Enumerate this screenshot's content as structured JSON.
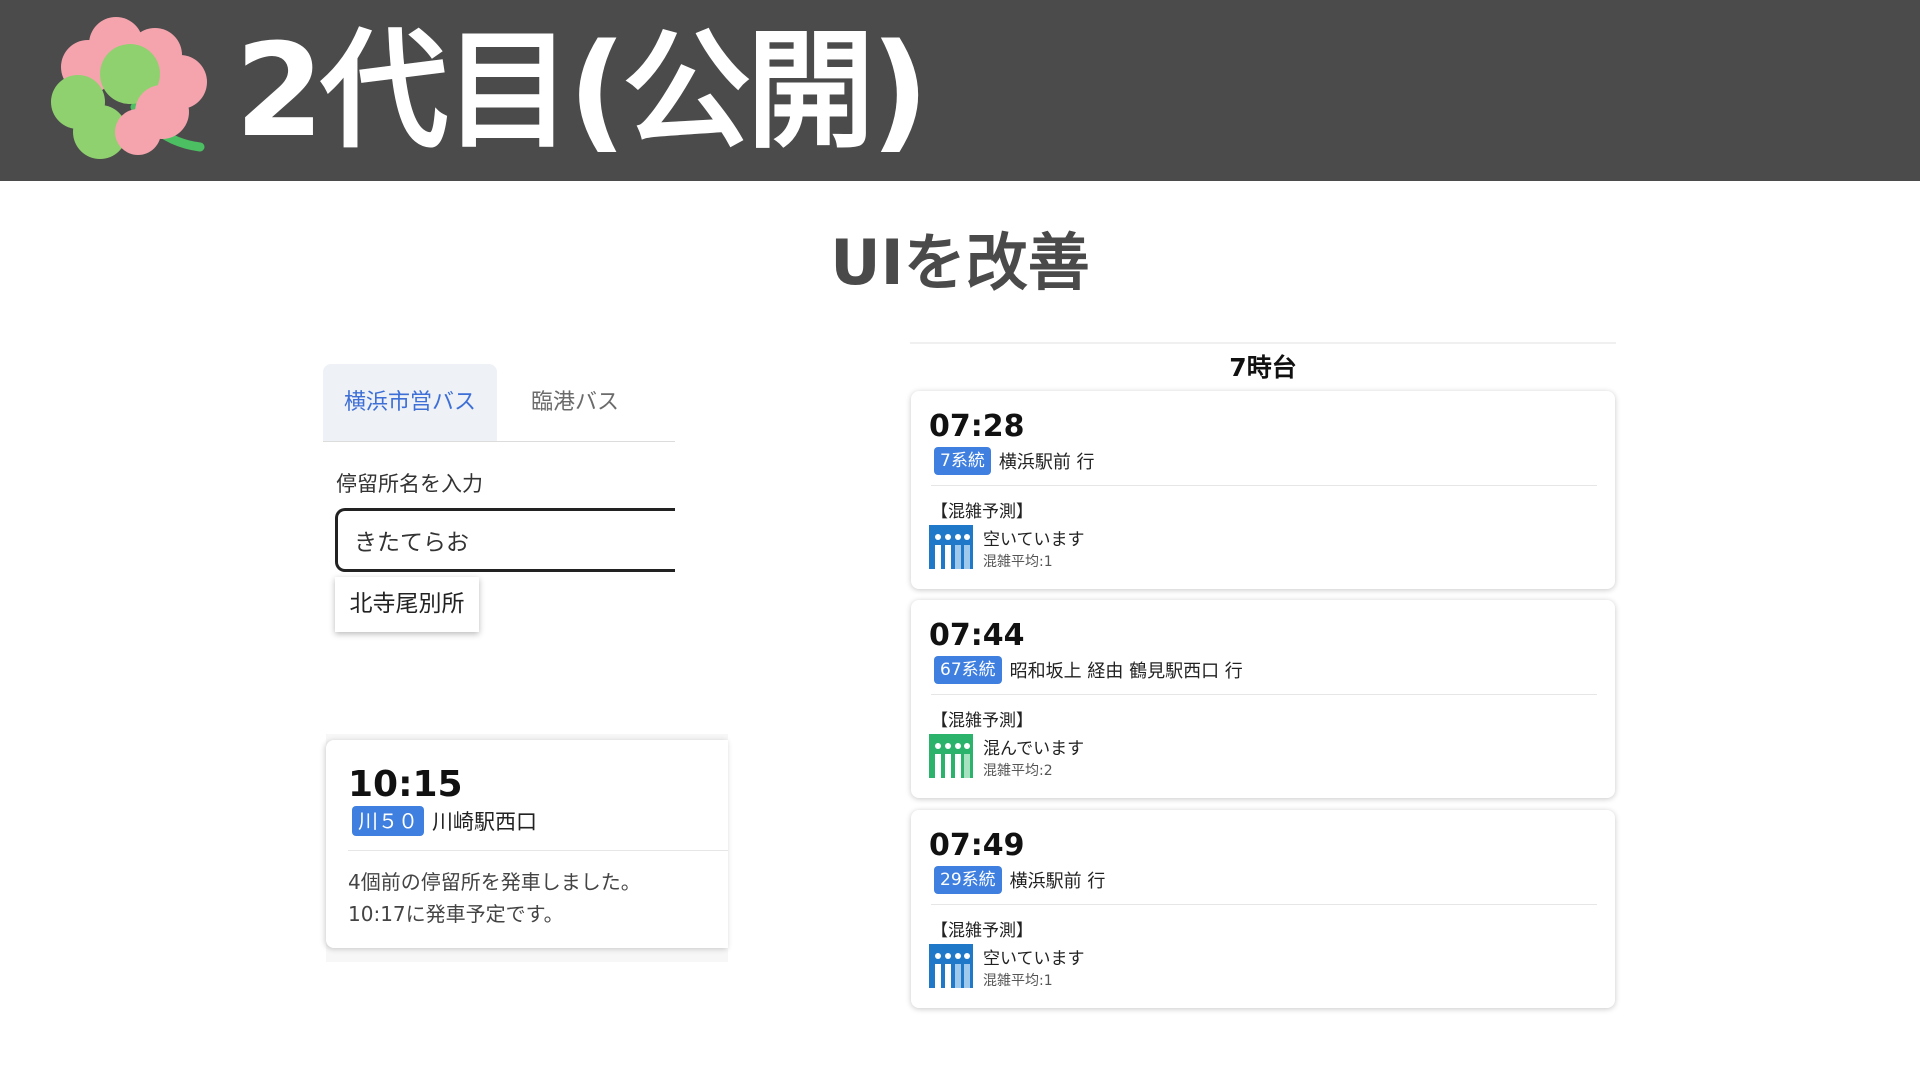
{
  "slide": {
    "title": "2代目(公開)",
    "subtitle": "UIを改善",
    "logo_icon": "four-leaf-clover-icon"
  },
  "search_panel": {
    "tabs": [
      {
        "label": "横浜市営バス",
        "active": true
      },
      {
        "label": "臨港バス",
        "active": false
      }
    ],
    "field_label": "停留所名を入力",
    "input_value": "きたてらお",
    "suggestion": "北寺尾別所",
    "accent_color": "#3d6fd6"
  },
  "arrival_card": {
    "time": "10:15",
    "route": "川５０",
    "destination": "川崎駅西口",
    "status_line1": "4個前の停留所を発車しました。",
    "status_line2": "10:17に発車予定です。"
  },
  "timetable": {
    "hour_label": "7時台",
    "departures": [
      {
        "time": "07:28",
        "route": "7系統",
        "destination": "横浜駅前 行",
        "crowd_header": "【混雑予測】",
        "crowd_text": "空いています",
        "crowd_avg": "混雑平均:1",
        "crowd_color": "#1f78c8"
      },
      {
        "time": "07:44",
        "route": "67系統",
        "destination": "昭和坂上 経由 鶴見駅西口 行",
        "crowd_header": "【混雑予測】",
        "crowd_text": "混んでいます",
        "crowd_avg": "混雑平均:2",
        "crowd_color": "#2bb36b"
      },
      {
        "time": "07:49",
        "route": "29系統",
        "destination": "横浜駅前 行",
        "crowd_header": "【混雑予測】",
        "crowd_text": "空いています",
        "crowd_avg": "混雑平均:1",
        "crowd_color": "#1f78c8"
      }
    ]
  }
}
